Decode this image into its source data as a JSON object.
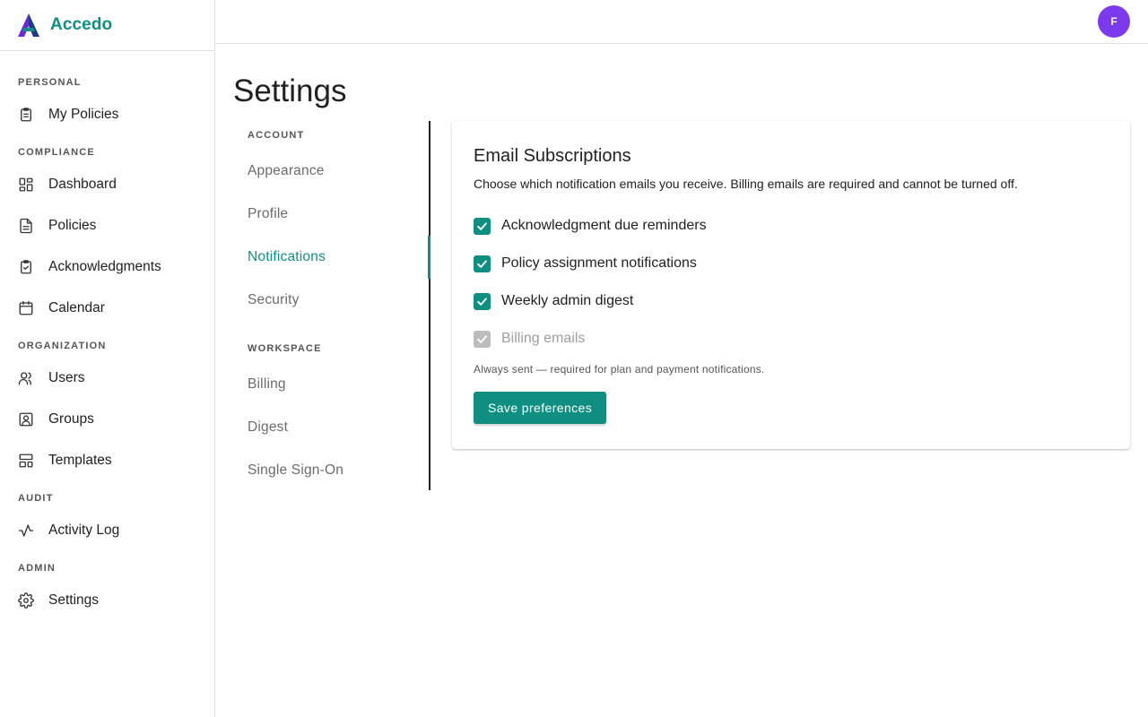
{
  "brand": {
    "name": "Accedo",
    "color": "#0f8f82"
  },
  "sidebar": {
    "sections": [
      {
        "title": "PERSONAL",
        "items": [
          {
            "label": "My Policies",
            "icon": "clipboard-list-icon"
          }
        ]
      },
      {
        "title": "COMPLIANCE",
        "items": [
          {
            "label": "Dashboard",
            "icon": "dashboard-grid-icon"
          },
          {
            "label": "Policies",
            "icon": "document-icon"
          },
          {
            "label": "Acknowledgments",
            "icon": "clipboard-check-icon"
          },
          {
            "label": "Calendar",
            "icon": "calendar-icon"
          }
        ]
      },
      {
        "title": "ORGANIZATION",
        "items": [
          {
            "label": "Users",
            "icon": "users-icon"
          },
          {
            "label": "Groups",
            "icon": "user-square-icon"
          },
          {
            "label": "Templates",
            "icon": "templates-icon"
          }
        ]
      },
      {
        "title": "AUDIT",
        "items": [
          {
            "label": "Activity Log",
            "icon": "activity-icon"
          }
        ]
      },
      {
        "title": "ADMIN",
        "items": [
          {
            "label": "Settings",
            "icon": "gear-icon"
          }
        ]
      }
    ]
  },
  "topbar": {
    "avatar_initial": "F",
    "avatar_color": "#7c3aed"
  },
  "page": {
    "title": "Settings"
  },
  "subnav": {
    "account_title": "ACCOUNT",
    "account_items": [
      "Appearance",
      "Profile",
      "Notifications",
      "Security"
    ],
    "workspace_title": "WORKSPACE",
    "workspace_items": [
      "Billing",
      "Digest",
      "Single Sign-On"
    ],
    "active": "Notifications"
  },
  "card": {
    "title": "Email Subscriptions",
    "description": "Choose which notification emails you receive. Billing emails are required and cannot be turned off.",
    "options": [
      {
        "label": "Acknowledgment due reminders",
        "checked": true,
        "disabled": false
      },
      {
        "label": "Policy assignment notifications",
        "checked": true,
        "disabled": false
      },
      {
        "label": "Weekly admin digest",
        "checked": true,
        "disabled": false
      },
      {
        "label": "Billing emails",
        "checked": true,
        "disabled": true
      }
    ],
    "help_text": "Always sent — required for plan and payment notifications.",
    "save_label": "Save preferences"
  }
}
